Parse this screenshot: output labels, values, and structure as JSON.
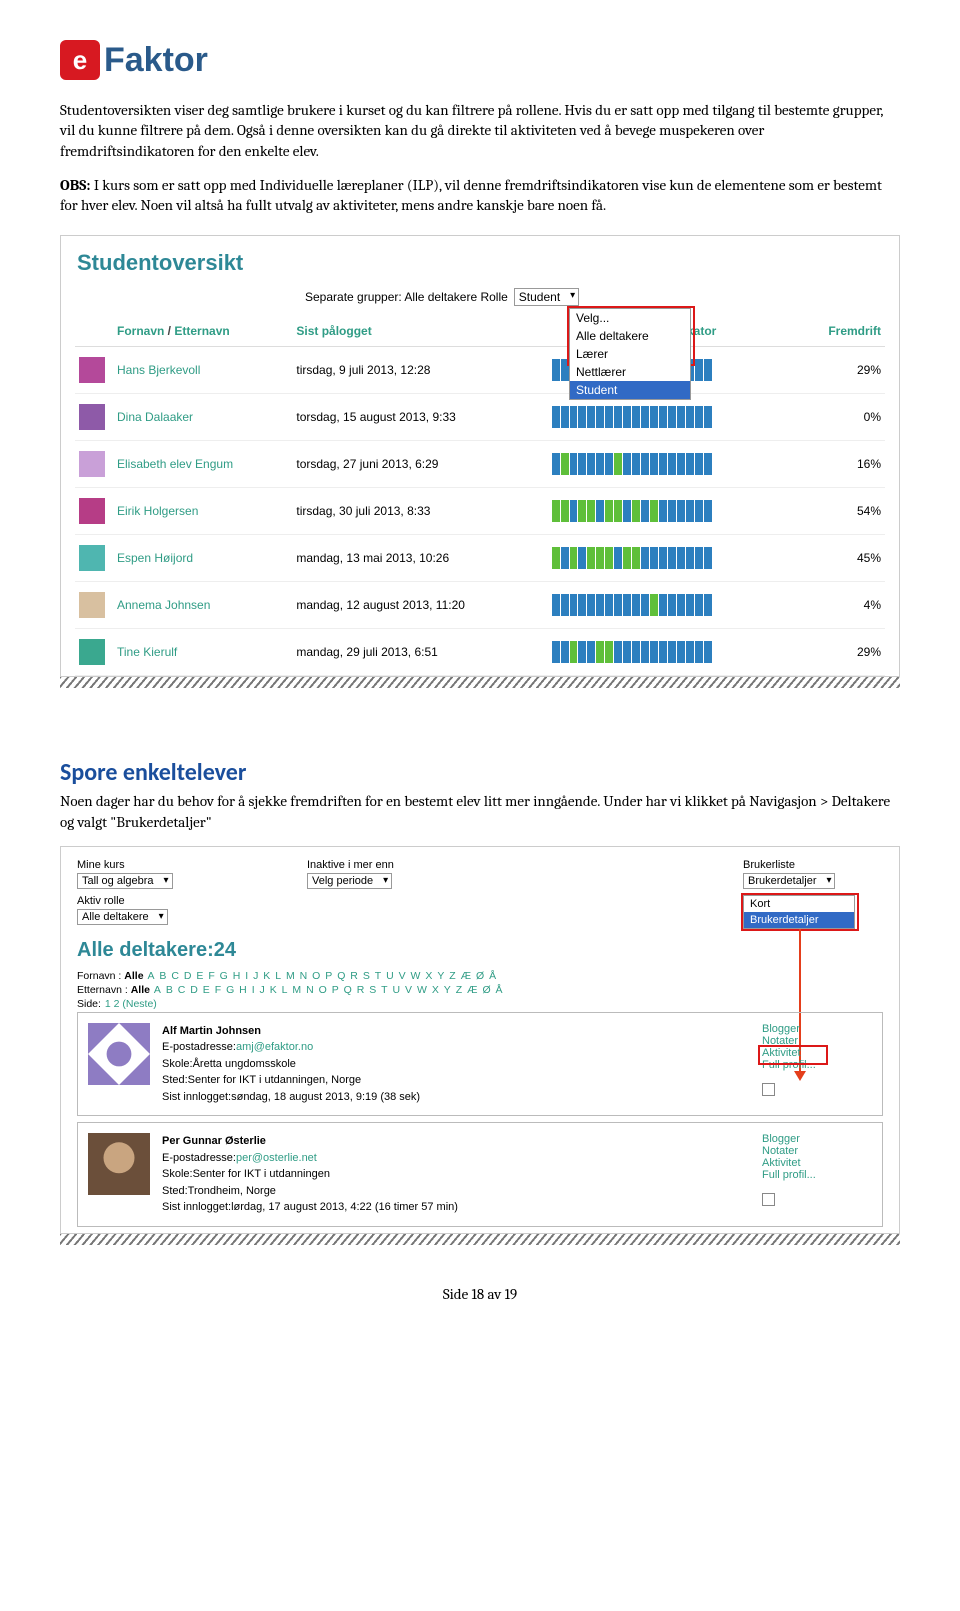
{
  "logo": {
    "e": "e",
    "brand": "Faktor"
  },
  "para1": "Studentoversikten viser deg samtlige brukere i kurset og du kan filtrere på rollene. Hvis du er satt opp med tilgang til bestemte grupper, vil du kunne filtrere på dem. Også i denne oversikten kan du gå direkte til aktiviteten ved å bevege muspekeren over fremdriftsindikatoren for den enkelte elev.",
  "obs_label": "OBS:",
  "para2": " I kurs som er satt opp med Individuelle læreplaner (ILP), vil denne fremdriftsindikatoren vise kun de elementene som er bestemt for hver elev. Noen vil altså ha fullt utvalg av aktiviteter, mens andre kanskje bare noen få.",
  "shot1": {
    "title": "Studentoversikt",
    "sep_label": "Separate grupper: Alle deltakere Rolle",
    "sel_value": "Student",
    "dropdown": [
      "Velg...",
      "Alle deltakere",
      "Lærer",
      "Nettlærer",
      "Student"
    ],
    "headers": {
      "c1": "Fornavn",
      "c1b": "Etternavn",
      "c2": "Sist pålogget",
      "c3": "iftsindikator",
      "c4": "Fremdrift"
    },
    "rows": [
      {
        "name": "Hans Bjerkevoll",
        "date": "tirsdag, 9 juli 2013, 12:28",
        "pct": "29%",
        "seg": "bbbbggggbbbbbbbbbb",
        "av": "#b4499a"
      },
      {
        "name": "Dina Dalaaker",
        "date": "torsdag, 15 august 2013, 9:33",
        "pct": "0%",
        "seg": "bbbbbbbbbbbbbbbbbb",
        "av": "#8e5aa8"
      },
      {
        "name": "Elisabeth elev Engum",
        "date": "torsdag, 27 juni 2013, 6:29",
        "pct": "16%",
        "seg": "bgbbbbbgbbbbbbbbbb",
        "av": "#c9a0d8"
      },
      {
        "name": "Eirik Holgersen",
        "date": "tirsdag, 30 juli 2013, 8:33",
        "pct": "54%",
        "seg": "ggbggbggbgbgbbbbbb",
        "av": "#b63d86"
      },
      {
        "name": "Espen Høijord",
        "date": "mandag, 13 mai 2013, 10:26",
        "pct": "45%",
        "seg": "gbgbgggbggbbbbbbbb",
        "av": "#4fb6b0"
      },
      {
        "name": "Annema Johnsen",
        "date": "mandag, 12 august 2013, 11:20",
        "pct": "4%",
        "seg": "bbbbbbbbbbbgbbbbbb",
        "av": "#d8c0a0"
      },
      {
        "name": "Tine Kierulf",
        "date": "mandag, 29 juli 2013, 6:51",
        "pct": "29%",
        "seg": "bbgbbggbbbbbbbbbbb",
        "av": "#3aa88f"
      }
    ]
  },
  "section2_title": "Spore enkeltelever",
  "section2_text": "Noen dager har du behov for å sjekke fremdriften for en bestemt elev litt mer inngående. Under har vi klikket på Navigasjon > Deltakere og valgt \"Brukerdetaljer\"",
  "shot2": {
    "labels": {
      "minekurs": "Mine kurs",
      "inaktive": "Inaktive i mer enn",
      "brukerliste": "Brukerliste",
      "aktivrolle": "Aktiv rolle"
    },
    "vals": {
      "kurs": "Tall og algebra",
      "periode": "Velg periode",
      "bliste": "Brukerdetaljer",
      "rolle": "Alle deltakere"
    },
    "dd": [
      "Kort",
      "Brukerdetaljer"
    ],
    "title": "Alle deltakere:24",
    "alpha_pfx_fn": "Fornavn : ",
    "alpha_pfx_en": "Etternavn : ",
    "alle": "Alle",
    "letters": "A B C D E F G H I J K L M N O P Q R S T U V W X Y Z Æ Ø Å",
    "side": "Side:",
    "side_links": "1 2 (Neste)",
    "user1": {
      "name": "Alf Martin Johnsen",
      "email_lbl": "E-postadresse:",
      "email": "amj@efaktor.no",
      "l1": "Skole:Åretta ungdomsskole",
      "l2": "Sted:Senter for IKT i utdanningen, Norge",
      "l3": "Sist innlogget:søndag, 18 august 2013, 9:19  (38 sek)",
      "links": [
        "Blogger",
        "Notater",
        "Aktivitet",
        "Full profil..."
      ]
    },
    "user2": {
      "name": "Per Gunnar Østerlie",
      "email_lbl": "E-postadresse:",
      "email": "per@osterlie.net",
      "l1": "Skole:Senter for IKT i utdanningen",
      "l2": "Sted:Trondheim, Norge",
      "l3": "Sist innlogget:lørdag, 17 august 2013, 4:22  (16 timer 57 min)",
      "links": [
        "Blogger",
        "Notater",
        "Aktivitet",
        "Full profil..."
      ]
    }
  },
  "footer": "Side 18 av 19"
}
